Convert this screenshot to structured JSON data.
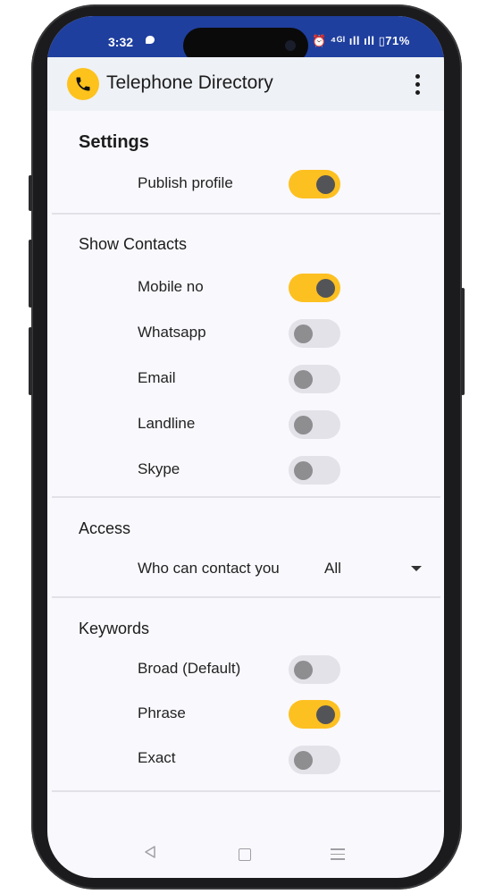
{
  "status": {
    "time": "3:32",
    "right_text": "⏰ ⁴ᴳᴵ ıll ıll ▯71%",
    "battery": "71%"
  },
  "app_bar": {
    "title": "Telephone Directory",
    "logo_icon": "phone-icon",
    "menu_icon": "more-vertical-icon"
  },
  "settings": {
    "title": "Settings",
    "publish_profile": {
      "label": "Publish profile",
      "on": true
    }
  },
  "show_contacts": {
    "title": "Show Contacts",
    "items": [
      {
        "label": "Mobile no",
        "on": true
      },
      {
        "label": "Whatsapp",
        "on": false
      },
      {
        "label": "Email",
        "on": false
      },
      {
        "label": "Landline",
        "on": false
      },
      {
        "label": "Skype",
        "on": false
      }
    ]
  },
  "access": {
    "title": "Access",
    "label": "Who can contact you",
    "value": "All"
  },
  "keywords": {
    "title": "Keywords",
    "items": [
      {
        "label": "Broad (Default)",
        "on": false
      },
      {
        "label": "Phrase",
        "on": true
      },
      {
        "label": "Exact",
        "on": false
      }
    ]
  },
  "colors": {
    "accent": "#fdc021",
    "status_bar": "#1f3f9e",
    "knob_on": "#535458"
  }
}
